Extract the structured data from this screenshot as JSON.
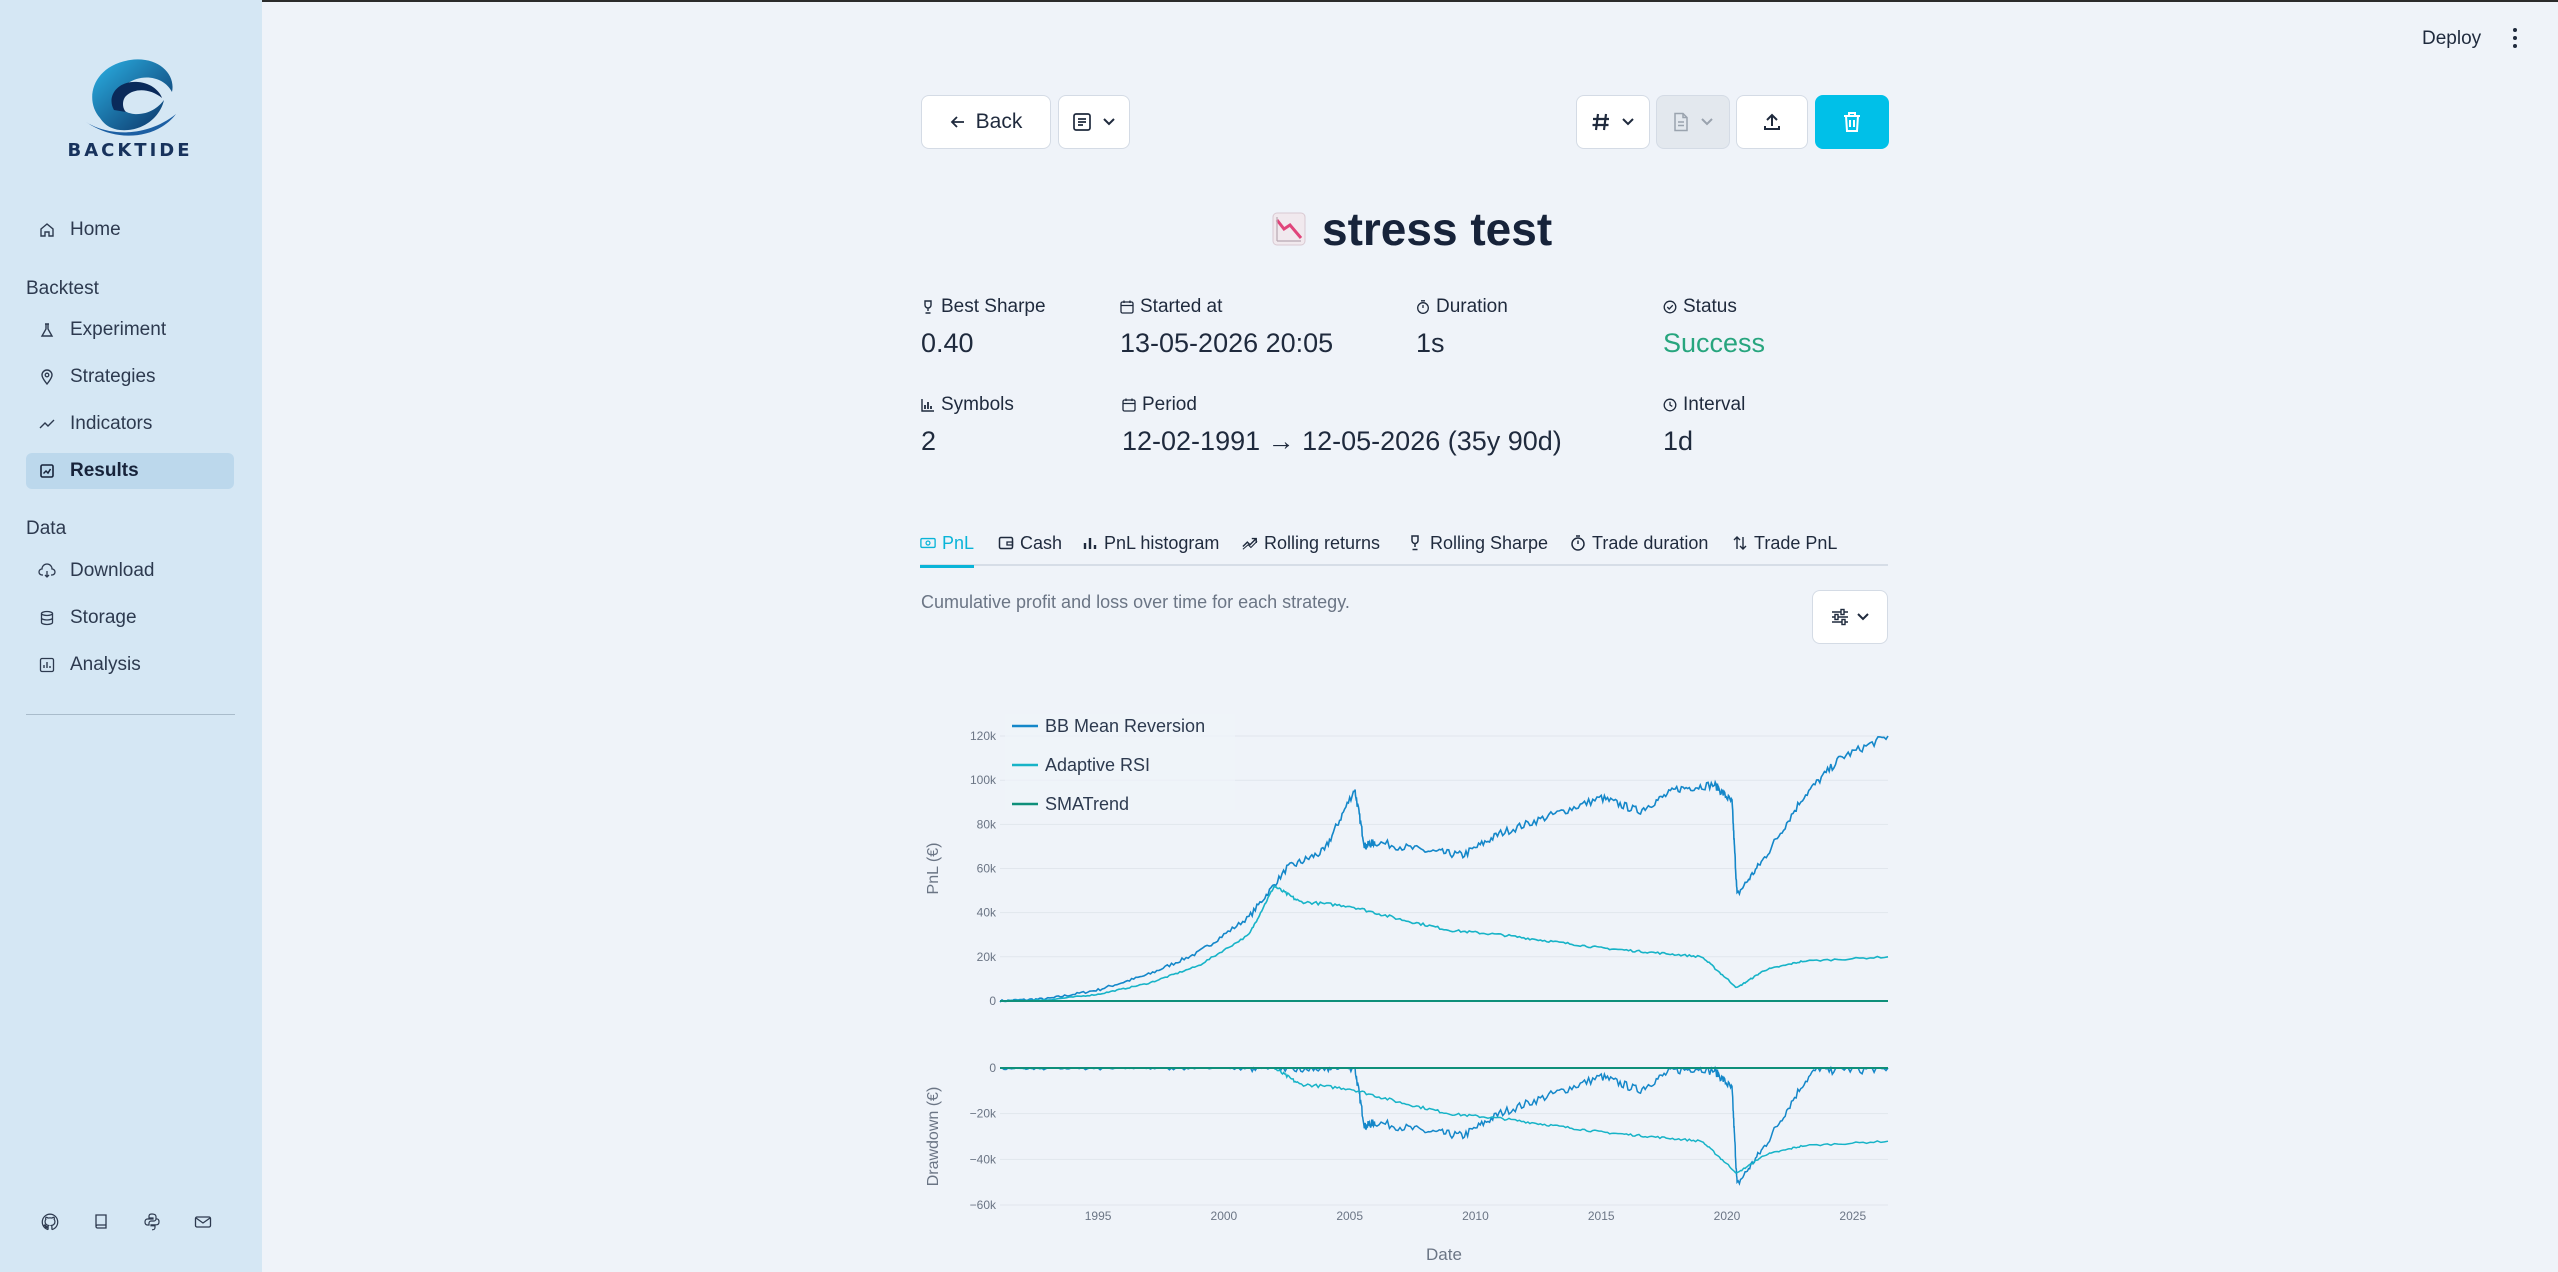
{
  "app": {
    "brand": "BACKTIDE"
  },
  "sidebar": {
    "home": "Home",
    "sections": [
      {
        "title": "Backtest",
        "items": [
          "Experiment",
          "Strategies",
          "Indicators",
          "Results"
        ]
      },
      {
        "title": "Data",
        "items": [
          "Download",
          "Storage",
          "Analysis"
        ]
      }
    ],
    "active": "Results",
    "footer_icons": [
      "github-icon",
      "book-icon",
      "python-icon",
      "mail-icon"
    ]
  },
  "header": {
    "deploy_label": "Deploy"
  },
  "toolbar": {
    "back_label": "Back",
    "icons": [
      "list-icon",
      "hash-icon",
      "file-icon",
      "upload-icon",
      "trash-icon"
    ]
  },
  "page": {
    "title": "stress test"
  },
  "metrics": {
    "best_sharpe": {
      "label": "Best Sharpe",
      "value": "0.40"
    },
    "started_at": {
      "label": "Started at",
      "value": "13-05-2026 20:05"
    },
    "duration": {
      "label": "Duration",
      "value": "1s"
    },
    "status": {
      "label": "Status",
      "value": "Success"
    },
    "symbols": {
      "label": "Symbols",
      "value": "2"
    },
    "period": {
      "label": "Period",
      "value": "12-02-1991 → 12-05-2026 (35y 90d)"
    },
    "interval": {
      "label": "Interval",
      "value": "1d"
    }
  },
  "tabs": [
    "PnL",
    "Cash",
    "PnL histogram",
    "Rolling returns",
    "Rolling Sharpe",
    "Trade duration",
    "Trade PnL"
  ],
  "active_tab": "PnL",
  "caption": "Cumulative profit and loss over time for each strategy.",
  "colors": {
    "accent": "#00c0e8",
    "success": "#27a57e",
    "bb": "#1487c9",
    "rsi": "#17b3c7",
    "sma": "#0e8f7a"
  },
  "chart_data": {
    "type": "line",
    "xlabel": "Date",
    "ylabel_top": "PnL (€)",
    "ylabel_bottom": "Drawdown (€)",
    "x_ticks": [
      "1995",
      "2000",
      "2005",
      "2010",
      "2015",
      "2020",
      "2025"
    ],
    "y_ticks_top": [
      "0",
      "20k",
      "40k",
      "60k",
      "80k",
      "100k",
      "120k"
    ],
    "y_ticks_bottom": [
      "0",
      "−20k",
      "−40k",
      "−60k"
    ],
    "ylim_top": [
      -5000,
      125000
    ],
    "ylim_bottom": [
      -60000,
      0
    ],
    "legend": "top-left",
    "series": [
      {
        "name": "BB Mean Reversion",
        "x": [
          1991.1,
          1993,
          1995,
          1997,
          1999,
          2001,
          2002.5,
          2004,
          2005.2,
          2005.6,
          2006,
          2008,
          2009.5,
          2011,
          2013,
          2015,
          2016.5,
          2018,
          2019.5,
          2020.2,
          2020.4,
          2021.5,
          2023,
          2024.5,
          2026.4
        ],
        "values": [
          0,
          1000,
          5000,
          12000,
          22000,
          38000,
          60000,
          68000,
          96000,
          70000,
          72000,
          68000,
          66000,
          76000,
          84000,
          92000,
          86000,
          96000,
          98000,
          90000,
          48000,
          65000,
          92000,
          110000,
          120000
        ]
      },
      {
        "name": "Adaptive RSI",
        "x": [
          1991.1,
          1993,
          1995,
          1997,
          1999,
          2001,
          2002,
          2003,
          2005,
          2007,
          2009,
          2011,
          2013,
          2015,
          2017,
          2019,
          2020.4,
          2021.5,
          2023,
          2026.4
        ],
        "values": [
          0,
          500,
          3000,
          8000,
          16000,
          30000,
          52000,
          45000,
          43000,
          37000,
          32000,
          30000,
          27000,
          24000,
          22000,
          20000,
          6000,
          14000,
          18000,
          20000
        ]
      },
      {
        "name": "SMATrend",
        "x": [
          1991.1,
          2000,
          2010,
          2020,
          2026.4
        ],
        "values": [
          0,
          0,
          0,
          0,
          0
        ]
      }
    ]
  }
}
